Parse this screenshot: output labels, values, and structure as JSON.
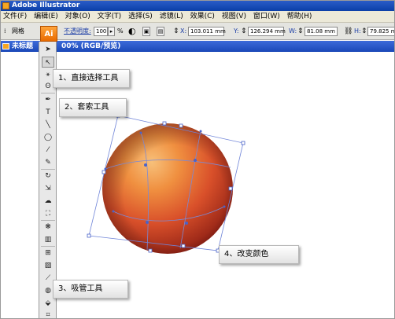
{
  "window": {
    "title": "Adobe Illustrator"
  },
  "menu": [
    "文件(F)",
    "编辑(E)",
    "对象(O)",
    "文字(T)",
    "选择(S)",
    "滤镜(L)",
    "效果(C)",
    "视图(V)",
    "窗口(W)",
    "帮助(H)"
  ],
  "control": {
    "mode_label": "网格",
    "opacity_label": "不透明度:",
    "opacity_value": "100",
    "opacity_unit": "%",
    "x_label": "X:",
    "x_value": "103.011 mm",
    "y_label": "Y:",
    "y_value": "126.294 mm",
    "w_label": "W:",
    "w_value": "81.08 mm",
    "h_label": "H:",
    "h_value": "79.825 mm"
  },
  "app_badge": "Ai",
  "document": {
    "title_left": "未标题",
    "title_right": "00% (RGB/预览)"
  },
  "callouts": {
    "c1": "1、直接选择工具",
    "c2": "2、套索工具",
    "c3": "3、吸管工具",
    "c4": "4、改变颜色"
  },
  "colors": {
    "titlebar": "#0b3fa8",
    "sphere_light": "#f7b96d",
    "sphere_mid": "#e2582b",
    "sphere_dark": "#8e1f14",
    "mesh_line": "#6b7fd6",
    "accent_orange": "#f08a1c"
  },
  "tools": [
    "selection-arrow-icon",
    "direct-selection-icon",
    "magic-wand-icon",
    "lasso-icon",
    "pen-icon",
    "type-icon",
    "line-icon",
    "ellipse-icon",
    "paintbrush-icon",
    "pencil-icon",
    "rotate-icon",
    "scale-icon",
    "warp-icon",
    "free-transform-icon",
    "symbol-sprayer-icon",
    "graph-icon",
    "mesh-icon",
    "gradient-icon",
    "eyedropper-icon",
    "blend-icon",
    "live-paint-icon",
    "crop-area-icon"
  ]
}
